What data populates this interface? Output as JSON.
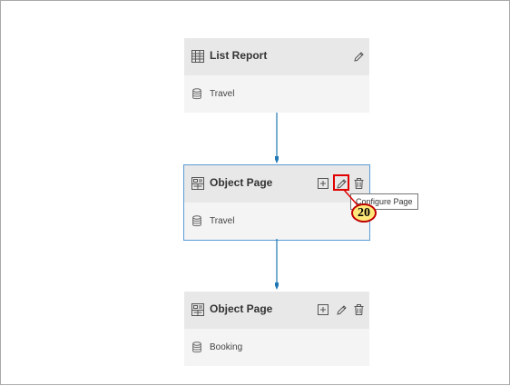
{
  "cards": [
    {
      "title": "List Report",
      "entity": "Travel",
      "actions": [
        "edit-icon"
      ]
    },
    {
      "title": "Object Page",
      "entity": "Travel",
      "actions": [
        "add-icon",
        "edit-icon",
        "delete-icon"
      ]
    },
    {
      "title": "Object Page",
      "entity": "Booking",
      "actions": [
        "add-icon",
        "edit-icon",
        "delete-icon"
      ]
    }
  ],
  "tooltip": "Configure Page",
  "callout_number": "20",
  "colors": {
    "connector": "#1f77b4",
    "selected_border": "#5b9bd5",
    "highlight": "#e00000",
    "badge_fill": "#ffe97a"
  }
}
